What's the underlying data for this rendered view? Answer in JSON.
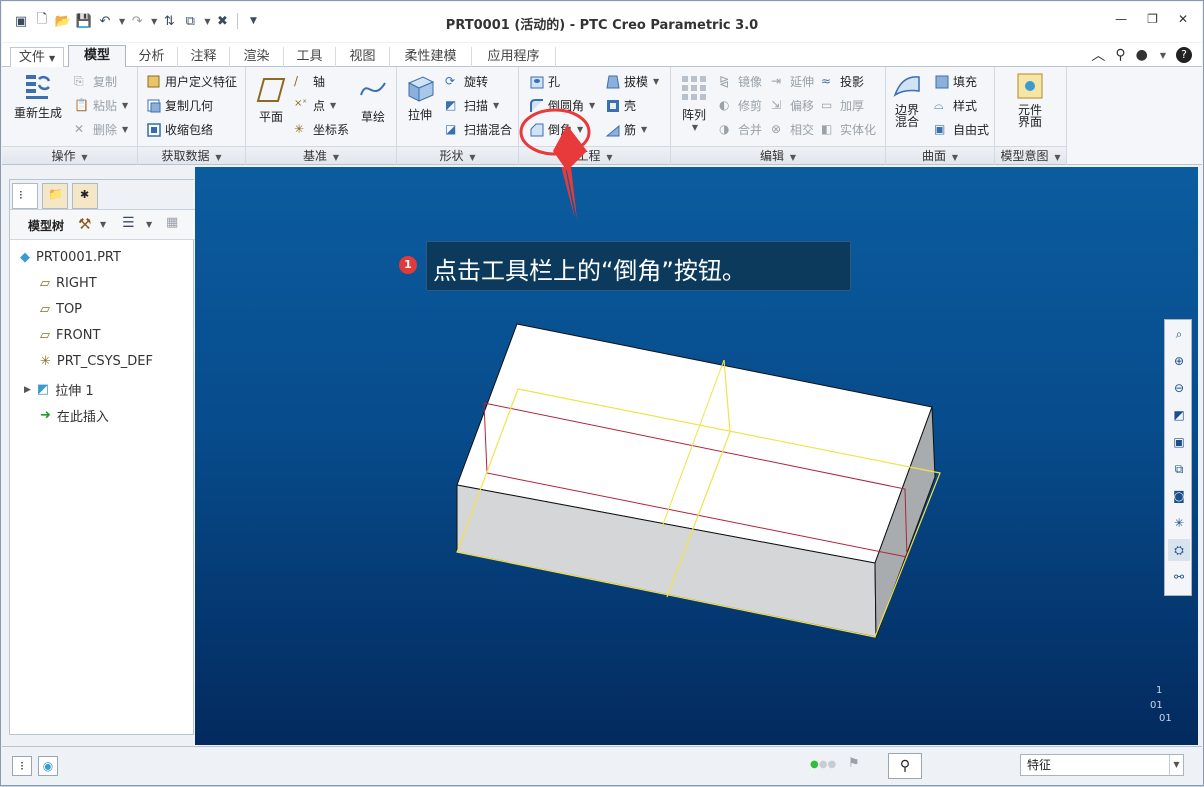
{
  "window": {
    "title": "PRT0001 (活动的) - PTC Creo Parametric 3.0"
  },
  "ribbon_tabs": [
    "文件",
    "模型",
    "分析",
    "注释",
    "渲染",
    "工具",
    "视图",
    "柔性建模",
    "应用程序"
  ],
  "groups": {
    "operations": {
      "label": "操作",
      "regenerate": "重新生成",
      "copy": "复制",
      "paste": "粘贴",
      "delete": "删除"
    },
    "get_data": {
      "label": "获取数据",
      "udf": "用户定义特征",
      "copy_geom": "复制几何",
      "shrinkwrap": "收缩包络"
    },
    "datum": {
      "label": "基准",
      "plane": "平面",
      "axis": "轴",
      "point": "点",
      "csys": "坐标系",
      "sketch": "草绘"
    },
    "shape": {
      "label": "形状",
      "extrude": "拉伸",
      "revolve": "旋转",
      "sweep": "扫描",
      "swept_blend": "扫描混合"
    },
    "engineering": {
      "label": "工程",
      "hole": "孔",
      "round": "倒圆角",
      "chamfer": "倒角",
      "draft": "拔模",
      "shell": "壳",
      "rib": "筋"
    },
    "editing": {
      "label": "编辑",
      "pattern": "阵列",
      "mirror": "镜像",
      "trim": "修剪",
      "merge": "合并",
      "extend": "延伸",
      "offset": "偏移",
      "intersect": "相交",
      "project": "投影",
      "thicken": "加厚",
      "solidify": "实体化"
    },
    "surfaces": {
      "label": "曲面",
      "boundary_blend_1": "边界",
      "boundary_blend_2": "混合",
      "fill": "填充",
      "style": "样式",
      "freestyle": "自由式"
    },
    "model_intent": {
      "label": "模型意图",
      "component_interface_1": "元件",
      "component_interface_2": "界面"
    }
  },
  "sidebar": {
    "tool_label": "模型树",
    "tree": [
      "PRT0001.PRT",
      "RIGHT",
      "TOP",
      "FRONT",
      "PRT_CSYS_DEF",
      "拉伸 1",
      "在此插入"
    ]
  },
  "callout": {
    "badge": "1",
    "text": "点击工具栏上的“倒角”按钮。"
  },
  "status": {
    "filter": "特征"
  },
  "axis_labels": {
    "a": "1",
    "b": "01",
    "c": "01"
  },
  "colors": {
    "viewport_top": "#0b5c9f",
    "viewport_bottom": "#032a5e",
    "highlight": "#e83a3a",
    "edge_yellow": "#f2e24a"
  }
}
